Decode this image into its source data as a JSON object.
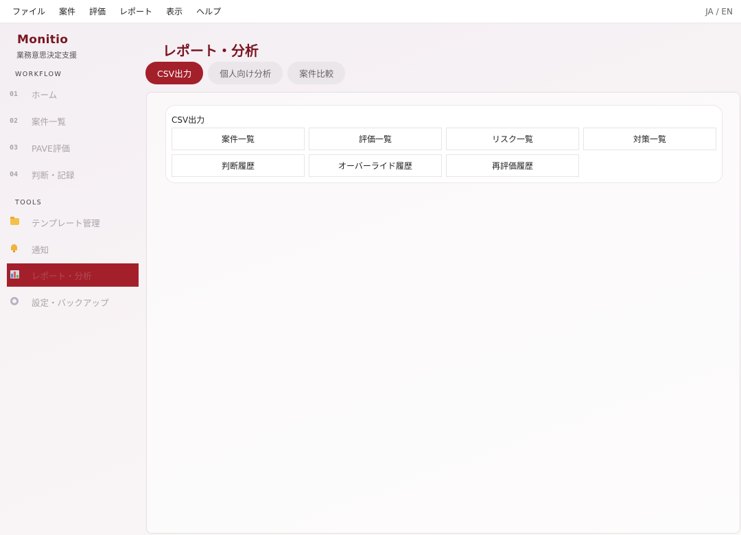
{
  "menubar": {
    "items": [
      "ファイル",
      "案件",
      "評価",
      "レポート",
      "表示",
      "ヘルプ"
    ],
    "lang": "JA / EN"
  },
  "sidebar": {
    "brand": "Monitio",
    "brand_sub": "業務意思決定支援",
    "workflow_label": "WORKFLOW",
    "workflow_items": [
      {
        "num": "01",
        "label": "ホーム"
      },
      {
        "num": "02",
        "label": "案件一覧"
      },
      {
        "num": "03",
        "label": "PAVE評価"
      },
      {
        "num": "04",
        "label": "判断・記録"
      }
    ],
    "tools_label": "TOOLS",
    "tools_items": [
      {
        "icon": "folder-icon",
        "label": "テンプレート管理"
      },
      {
        "icon": "bell-icon",
        "label": "通知"
      },
      {
        "icon": "chart-icon",
        "label": "レポート・分析"
      },
      {
        "icon": "gear-icon",
        "label": "設定・バックアップ"
      }
    ],
    "active_item": "レポート・分析"
  },
  "main": {
    "title": "レポート・分析",
    "tabs": [
      {
        "label": "CSV出力",
        "active": true
      },
      {
        "label": "個人向け分析",
        "active": false
      },
      {
        "label": "案件比較",
        "active": false
      }
    ],
    "csv_card": {
      "title": "CSV出力",
      "buttons": [
        "案件一覧",
        "評価一覧",
        "リスク一覧",
        "対策一覧",
        "判断履歴",
        "オーバーライド履歴",
        "再評価履歴"
      ]
    }
  },
  "colors": {
    "accent": "#a3202b",
    "brand": "#7a1420"
  }
}
